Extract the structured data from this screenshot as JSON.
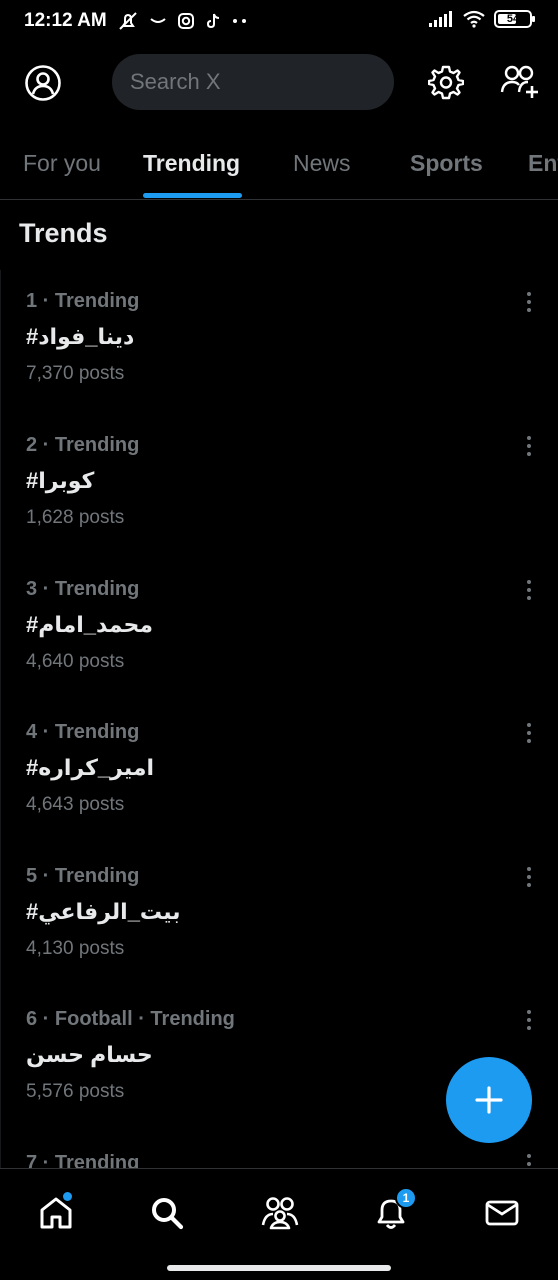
{
  "status_bar": {
    "time": "12:12 AM",
    "battery": "54",
    "icons": [
      "mute-icon",
      "message-icon",
      "instagram-icon",
      "tiktok-icon",
      "more-dots-icon",
      "signal-icon",
      "wifi-icon",
      "battery-icon"
    ]
  },
  "header": {
    "search_placeholder": "Search X",
    "icons": [
      "profile-icon",
      "settings-icon",
      "follow-people-icon"
    ]
  },
  "tabs": [
    {
      "label": "For you",
      "active": false
    },
    {
      "label": "Trending",
      "active": true
    },
    {
      "label": "News",
      "active": false
    },
    {
      "label": "Sports",
      "active": false
    },
    {
      "label": "Ent",
      "active": false
    }
  ],
  "section_title": "Trends",
  "trends": [
    {
      "meta": "1 · Trending",
      "name": "#دينا_فواد",
      "posts": "7,370 posts"
    },
    {
      "meta": "2 · Trending",
      "name": "#كوبرا",
      "posts": "1,628 posts"
    },
    {
      "meta": "3 · Trending",
      "name": "#محمد_امام",
      "posts": "4,640 posts"
    },
    {
      "meta": "4 · Trending",
      "name": "#امير_كراره",
      "posts": "4,643 posts"
    },
    {
      "meta": "5 · Trending",
      "name": "#بيت_الرفاعي",
      "posts": "4,130 posts"
    },
    {
      "meta": "6 · Football · Trending",
      "name": "حسام حسن",
      "posts": "5,576 posts"
    },
    {
      "meta": "7 · Trending",
      "name": "",
      "posts": ""
    }
  ],
  "bottom_nav": {
    "items": [
      "home-icon",
      "search-icon",
      "communities-icon",
      "notifications-icon",
      "messages-icon"
    ],
    "notification_count": "1"
  },
  "colors": {
    "background": "#000000",
    "accent": "#1d9bf0",
    "text_primary": "#e7e9ea",
    "text_secondary": "#71767b",
    "search_bg": "#202327"
  }
}
